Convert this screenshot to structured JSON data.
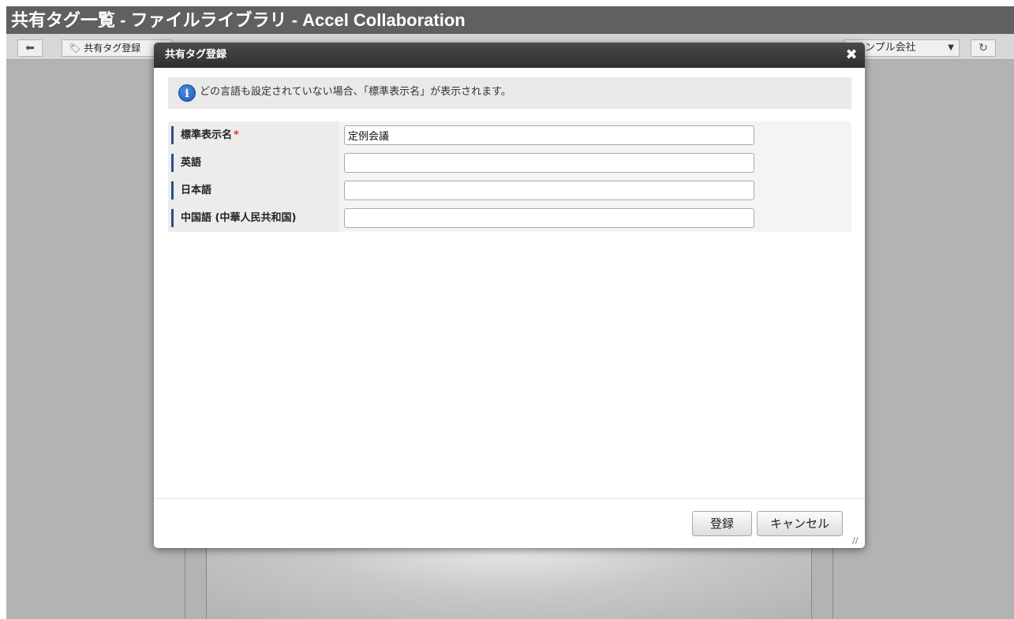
{
  "window": {
    "title": "共有タグ一覧 - ファイルライブラリ - Accel Collaboration"
  },
  "toolbar": {
    "back_icon": "arrow-left-icon",
    "add_label": "共有タグ登録",
    "company_label": "サンプル会社",
    "refresh_icon": "refresh-icon"
  },
  "dialog": {
    "title": "共有タグ登録",
    "close_symbol": "✖",
    "info_message": "どの言語も設定されていない場合、「標準表示名」が表示されます。",
    "fields": [
      {
        "label": "標準表示名",
        "required_mark": "*",
        "value": "定例会議"
      },
      {
        "label": "英語",
        "value": ""
      },
      {
        "label": "日本語",
        "value": ""
      },
      {
        "label": "中国語 (中華人民共和国)",
        "value": ""
      }
    ],
    "register_label": "登録",
    "cancel_label": "キャンセル"
  },
  "colors": {
    "dialog_header": "#333333",
    "label_accent": "#2c4f87",
    "required": "#e83030",
    "info_icon": "#1d58b4"
  }
}
